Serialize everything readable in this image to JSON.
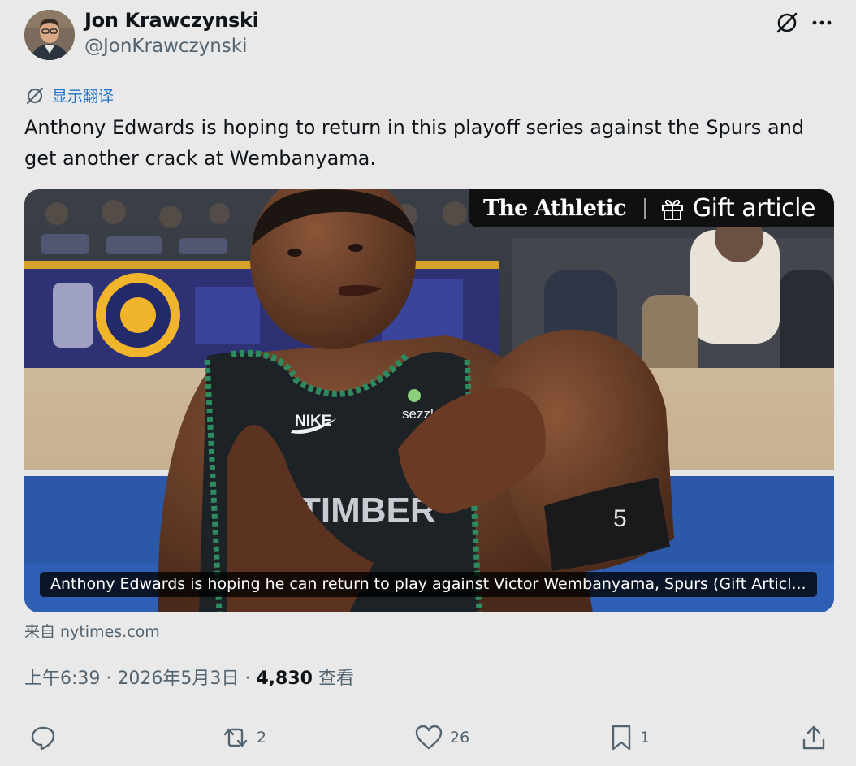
{
  "author": {
    "name": "Jon Krawczynski",
    "handle": "@JonKrawczynski"
  },
  "translate_label": "显示翻译",
  "tweet_text": "Anthony Edwards is hoping to return in this playoff series against the Spurs and get another crack at Wembanyama.",
  "card": {
    "brand": "The Athletic",
    "gift_label": "Gift article",
    "caption": "Anthony Edwards is hoping he can return to play against Victor Wembanyama, Spurs (Gift Articl...",
    "jersey_number": "5",
    "jersey_text": "TIMBER"
  },
  "source": "来自 nytimes.com",
  "meta": {
    "time_date": "上午6:39 · 2026年5月3日 · ",
    "views_count": "4,830",
    "views_label": " 查看"
  },
  "actions": {
    "replies": "",
    "reposts": "2",
    "likes": "26",
    "bookmarks": "1"
  },
  "icons": [
    "grok-icon",
    "more-icon",
    "translate-icon",
    "gift-icon",
    "reply-icon",
    "repost-icon",
    "like-icon",
    "bookmark-icon",
    "share-icon"
  ],
  "colors": {
    "link": "#1d73c9",
    "muted": "#536471",
    "text": "#0f1419",
    "background": "#e9e9ea"
  }
}
